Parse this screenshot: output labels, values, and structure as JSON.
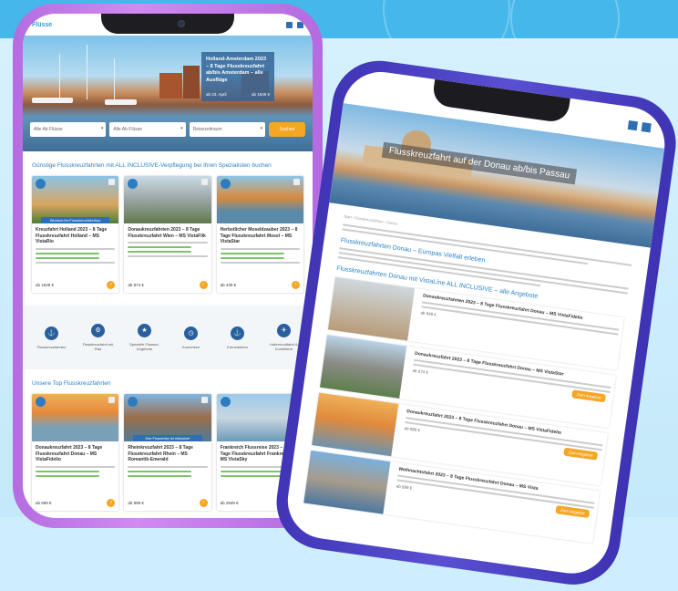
{
  "phone_left": {
    "brand": "Flüsse",
    "hero_card": {
      "title": "Holland-Amsterdam 2023 – 8 Tage Flusskreuzfahrt ab/bis Amsterdam – alle Ausflüge",
      "date_label": "ab 23. April",
      "price_label": "ab 1649 €"
    },
    "search": {
      "field1": "Alle Ab Flüsse",
      "field2": "Alle Ab Flüsse",
      "field3": "Reisezeitraum",
      "button": "Suchen"
    },
    "section1_title": "Günstige Flusskreuzfahrten mit ALL INCLUSIVE-Verpflegung bei Ihren Spezialisten buchen",
    "cards1": [
      {
        "title": "Kreuzfahrt Holland 2023 – 8 Tage Flusskreuzfahrt Holland – MS VistaRio",
        "ribbon": "Wunsch-Ihr-Flusskreuzfahrttour",
        "price": "ab 1649 €"
      },
      {
        "title": "Donaukreuzfahrten 2023 – 8 Tage Flusskreuzfahrt Wien – MS VistaFlik",
        "ribbon": "",
        "price": "ab 874 €"
      },
      {
        "title": "Herbstlicher Moseldzauber 2023 – 8 Tage Flusskreuzfahrt Mosel – MS VistaStar",
        "ribbon": "",
        "price": "ab 449 €"
      }
    ],
    "categories": [
      "Flusskreuzfahrten",
      "Flusskreuzfahrt mit Rad",
      "Spezielle Flussrei-Angebote",
      "Kurzreisen",
      "Kreuzfahrten",
      "Hafenrundfahrt & Kombifahrt"
    ],
    "section2_title": "Unsere Top Flusskreuzfahrten",
    "cards2": [
      {
        "title": "Donaukreuzfahrt 2023 – 8 Tage Flusskreuzfahrt Donau – MS VistaFidelio",
        "ribbon": "",
        "price": "ab 899 €"
      },
      {
        "title": "Rheinkreuzfahrt 2023 – 8 Tage Flusskreuzfahrt Rhein – MS Romantik-Emerald",
        "ribbon": "Ihre Flussreise ist inklusive!",
        "price": "ab 999 €"
      },
      {
        "title": "Frankreich Flussreise 2023 – 10 Tage Flusskreuzfahrt Frankreich – MS VistaSky",
        "ribbon": "",
        "price": "ab 2949 €"
      }
    ]
  },
  "phone_right": {
    "hero_title": "Flusskreuzfahrt auf der Donau ab/bis Passau",
    "breadcrumb": "Start › Flusskreuzfahrten › Donau",
    "section_a": "Flusskreuzfahrten Donau – Europas Vielfalt erleben",
    "section_b": "Flusskreuzfahrten Donau mit VistaLine ALL INCLUSIVE – alle Angebote",
    "offer_label": "Zum Angebot",
    "rows": [
      {
        "title": "Donaukreuzfahrten 2023 – 8 Tage Flusskreuzfahrt Donau – MS VistaFidelio",
        "price": "ab 949 €"
      },
      {
        "title": "Donaukreuzfahrt 2023 – 8 Tage Flusskreuzfahrt Donau – MS VistaStar",
        "price": "ab 874 €"
      },
      {
        "title": "Donaukreuzfahrt 2023 – 8 Tage Flusskreuzfahrt Donau – MS VistaFidelio",
        "price": "ab 999 €"
      },
      {
        "title": "Weihnachtsfahrt 2023 – 8 Tage Flusskreuzfahrt Donau – MS Vista",
        "price": "ab 899 €"
      }
    ]
  },
  "colors": {
    "accent_blue": "#2b82c7",
    "accent_orange": "#f5a623",
    "phone_left": "#c57ae8",
    "phone_right": "#4a40c4"
  }
}
